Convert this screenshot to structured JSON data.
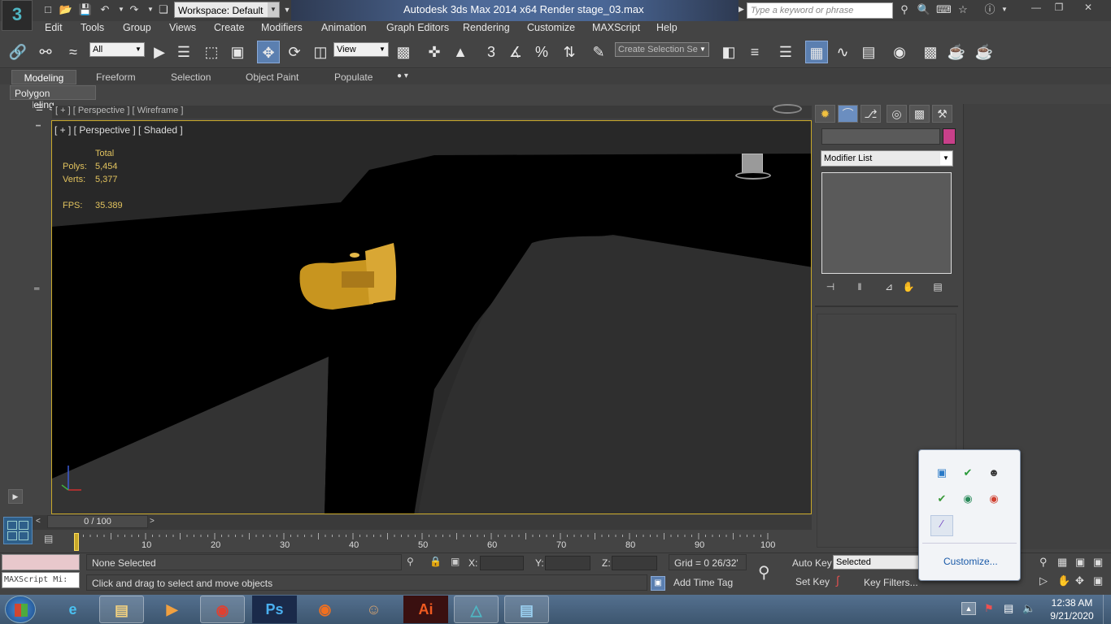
{
  "app": {
    "logo": "3",
    "title": "Autodesk 3ds Max  2014 x64     Render stage_03.max",
    "workspace": "Workspace: Default",
    "search_placeholder": "Type a keyword or phrase"
  },
  "menu": [
    "Edit",
    "Tools",
    "Group",
    "Views",
    "Create",
    "Modifiers",
    "Animation",
    "Graph Editors",
    "Rendering",
    "Customize",
    "MAXScript",
    "Help"
  ],
  "toolbar": {
    "filter_value": "All",
    "refcoord_value": "View",
    "selection_set_placeholder": "Create Selection Se",
    "snap_label": "3"
  },
  "ribbon": {
    "tabs": [
      "Modeling",
      "Freeform",
      "Selection",
      "Object Paint",
      "Populate"
    ],
    "active_tab": "Modeling",
    "subtab": "Polygon Modeling"
  },
  "viewport": {
    "top_label": "[ + ] [ Perspective ] [ Wireframe ]",
    "label": "[ + ] [ Perspective ] [ Shaded ]",
    "stats": {
      "header": "Total",
      "polys_label": "Polys:",
      "polys": "5,454",
      "verts_label": "Verts:",
      "verts": "5,377",
      "fps_label": "FPS:",
      "fps": "35.389"
    }
  },
  "command_panel": {
    "modifier_list": "Modifier List",
    "color": "#c8408a"
  },
  "timeline": {
    "frame_display": "0 / 100",
    "ticks": [
      "10",
      "20",
      "30",
      "40",
      "50",
      "60",
      "70",
      "80",
      "90",
      "100"
    ],
    "current_frame": 0,
    "total_frames": 100
  },
  "status": {
    "maxscript": "MAXScript Mi:",
    "selection": "None Selected",
    "prompt": "Click and drag to select and move objects",
    "x_label": "X:",
    "y_label": "Y:",
    "z_label": "Z:",
    "grid": "Grid = 0 26/32'",
    "add_time_tag": "Add Time Tag",
    "auto_key": "Auto Key",
    "set_key": "Set Key",
    "selected_value": "Selected",
    "key_filters": "Key Filters..."
  },
  "tray_popup": {
    "customize": "Customize..."
  },
  "taskbar": {
    "apps": [
      "Ps",
      "Ai"
    ],
    "time": "12:38 AM",
    "date": "9/21/2020"
  }
}
